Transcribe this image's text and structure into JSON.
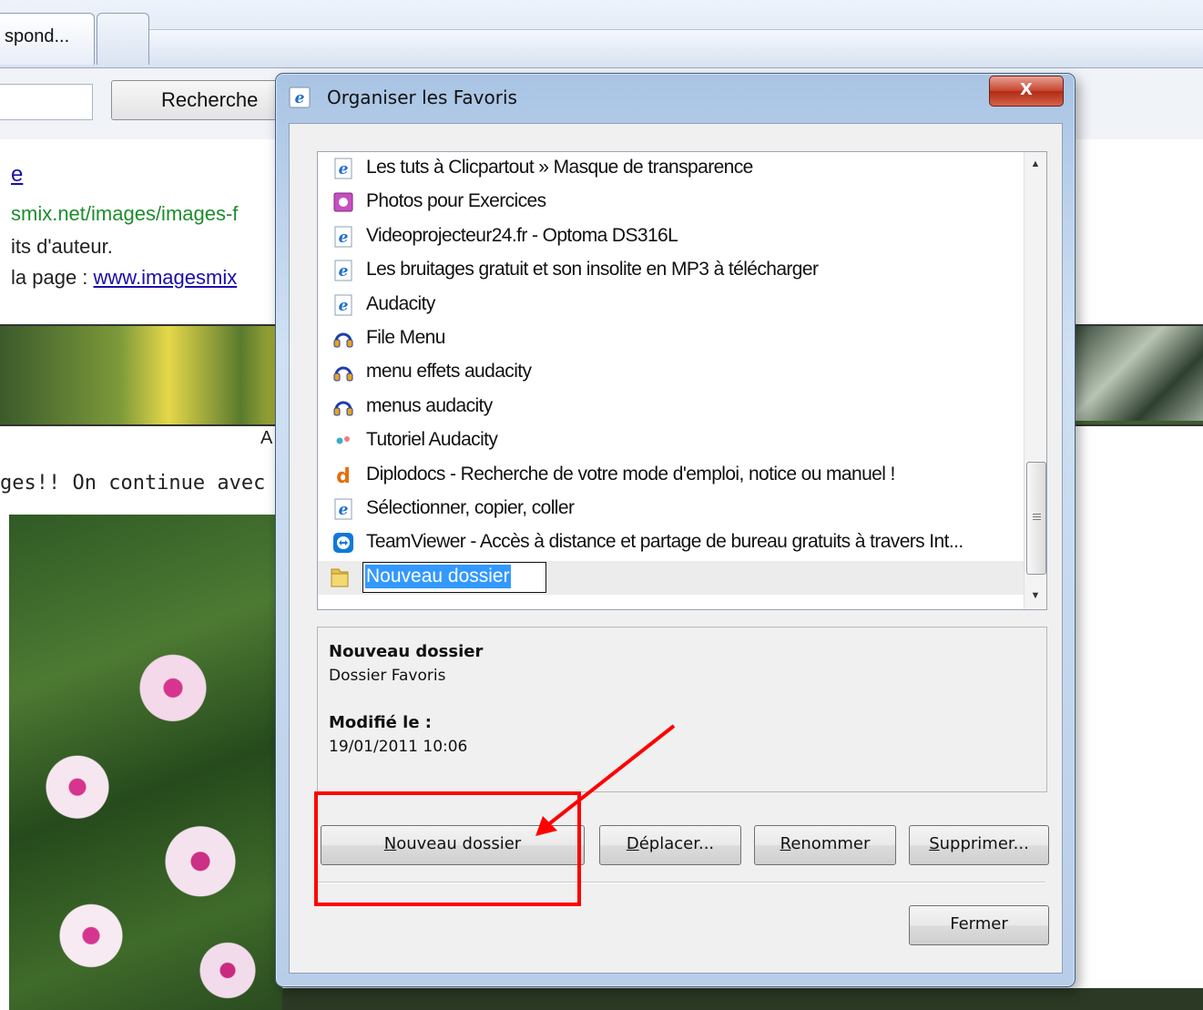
{
  "browser": {
    "tab_title": "spond...",
    "search_button": "Recherche",
    "search_value": ""
  },
  "webpage": {
    "link_title": "e",
    "url_text": "smix.net/images/images-f",
    "rights_text": "its d'auteur.",
    "page_prefix": "la page : ",
    "page_link": "www.imagesmix",
    "caption": "A",
    "body_text": "ges!! On continue avec"
  },
  "dialog": {
    "title": "Organiser les Favoris",
    "close_label": "X",
    "favorites": [
      {
        "label": "Les tuts à Clicpartout » Masque de transparence",
        "icon": "ie-page-icon"
      },
      {
        "label": "Photos pour Exercices",
        "icon": "photo-icon"
      },
      {
        "label": "Videoprojecteur24.fr - Optoma DS316L",
        "icon": "ie-page-icon"
      },
      {
        "label": "Les bruitages gratuit et son insolite en MP3 à télécharger",
        "icon": "ie-page-icon"
      },
      {
        "label": "Audacity",
        "icon": "ie-page-icon"
      },
      {
        "label": "File Menu",
        "icon": "headphones-icon"
      },
      {
        "label": "menu effets audacity",
        "icon": "headphones-icon"
      },
      {
        "label": "menus audacity",
        "icon": "headphones-icon"
      },
      {
        "label": "Tutoriel Audacity",
        "icon": "dots-icon"
      },
      {
        "label": "Diplodocs - Recherche de votre mode d'emploi, notice ou manuel !",
        "icon": "d-letter-icon"
      },
      {
        "label": "Sélectionner, copier, coller",
        "icon": "ie-page-icon"
      },
      {
        "label": "TeamViewer - Accès à distance et partage de bureau gratuits à travers Int...",
        "icon": "teamviewer-icon"
      }
    ],
    "new_folder_edit_value": "Nouveau dossier",
    "info": {
      "name": "Nouveau dossier",
      "type": "Dossier Favoris",
      "modified_label": "Modifié le :",
      "modified_value": "19/01/2011 10:06"
    },
    "buttons": {
      "new_folder": {
        "mnemonic": "N",
        "rest": "ouveau dossier"
      },
      "move": {
        "mnemonic": "D",
        "rest": "éplacer..."
      },
      "rename": {
        "mnemonic": "R",
        "rest": "enommer"
      },
      "delete": {
        "mnemonic": "S",
        "rest": "upprimer..."
      },
      "close": "Fermer"
    }
  },
  "colors": {
    "annotation": "#ff0000",
    "selection": "#3399ff",
    "close_button": "#c7432c"
  }
}
